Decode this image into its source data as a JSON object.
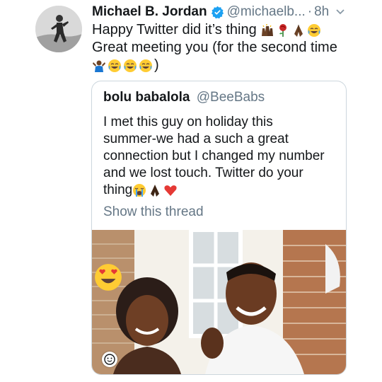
{
  "tweet": {
    "author_name": "Michael B. Jordan",
    "handle": "@michaelb...",
    "separator": "·",
    "time": "8h",
    "line1_text": "Happy Twitter did it’s thing",
    "line2_text": "Great meeting you (for the second time",
    "line3_text": ")",
    "line1_emojis": [
      "raising-hands-emoji",
      "rose-emoji",
      "folded-hands-emoji",
      "tears-of-joy-emoji"
    ],
    "line3_emojis": [
      "man-shrugging-emoji",
      "tears-of-joy-emoji",
      "tears-of-joy-emoji",
      "tears-of-joy-emoji"
    ]
  },
  "quoted": {
    "author_name": "bolu babalola",
    "handle": "@BeeBabs",
    "text_lines": [
      "I met this guy on holiday this",
      "summer-we had a such a great",
      "connection but I changed my number",
      "and we lost touch. Twitter do your",
      "thing"
    ],
    "trailing_emojis": [
      "loudly-crying-emoji",
      "folded-hands-emoji",
      "red-heart-emoji"
    ],
    "show_thread": "Show this thread",
    "media": {
      "sticker_icon": "heart-eyes-emoji",
      "media_button_icon": "smiley-icon"
    }
  },
  "colors": {
    "text": "#14171a",
    "secondary": "#657786",
    "border": "#ccd6dd",
    "verified": "#1da1f2"
  }
}
